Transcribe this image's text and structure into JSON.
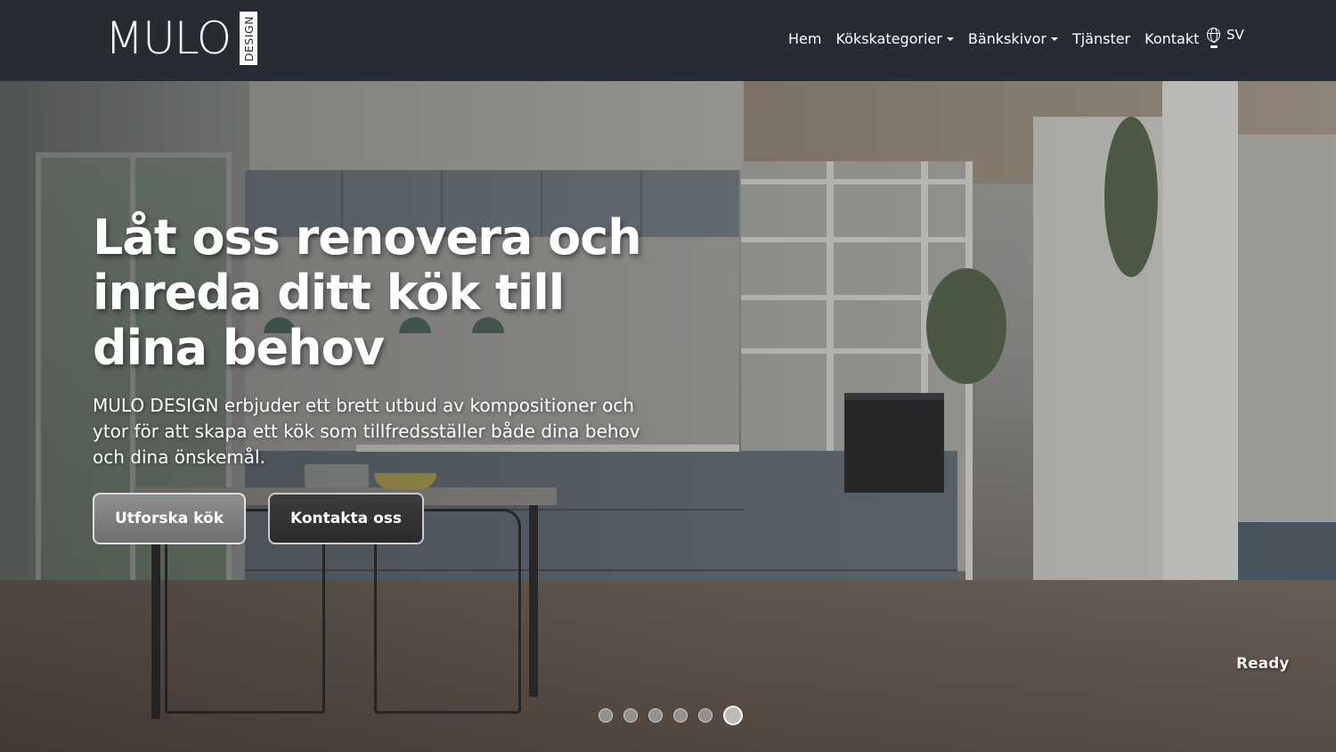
{
  "brand": {
    "name": "MULO",
    "tag": "DESIGN"
  },
  "nav": {
    "items": [
      {
        "label": "Hem",
        "dropdown": false
      },
      {
        "label": "Kökskategorier",
        "dropdown": true
      },
      {
        "label": "Bänkskivor",
        "dropdown": true
      },
      {
        "label": "Tjänster",
        "dropdown": false
      },
      {
        "label": "Kontakt",
        "dropdown": false
      }
    ],
    "language": {
      "label": "SV",
      "icon": "globe-icon"
    }
  },
  "hero": {
    "title": "Låt oss renovera och inreda ditt kök till dina behov",
    "subtitle": "MULO DESIGN erbjuder ett brett utbud av kompositioner och ytor för att skapa ett kök som tillfredsställer både dina behov och dina önskemål.",
    "primary_button": "Utforska kök",
    "secondary_button": "Kontakta oss",
    "image_caption": "Ready"
  },
  "carousel": {
    "slide_count": 6,
    "active_index": 5
  },
  "colors": {
    "navbar": "#272b33",
    "text": "#ffffff"
  }
}
